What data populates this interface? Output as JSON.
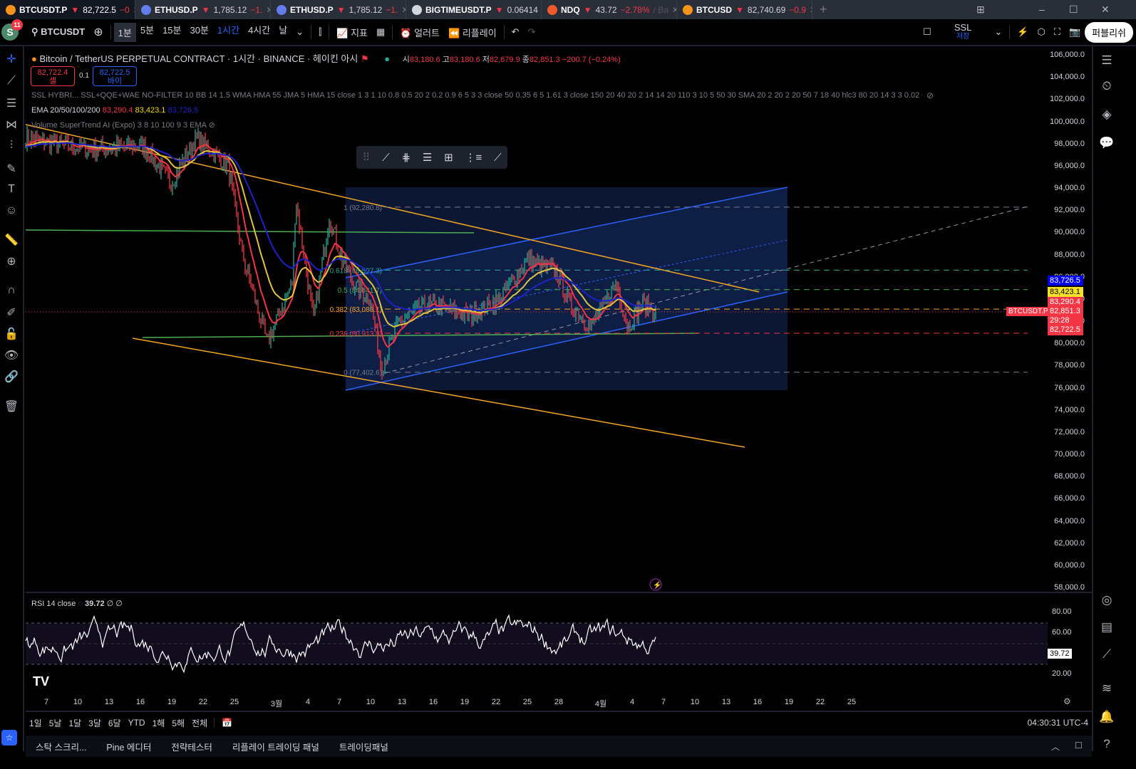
{
  "tabs": [
    {
      "symbol": "BTCUSDT.P",
      "price": "82,722.5",
      "change": "−0",
      "color": "#f7931a",
      "active": true
    },
    {
      "symbol": "ETHUSD.P",
      "price": "1,785.12",
      "change": "−1.",
      "color": "#627eea"
    },
    {
      "symbol": "ETHUSD.P",
      "price": "1,785.12",
      "change": "−1.",
      "color": "#627eea"
    },
    {
      "symbol": "BIGTIMEUSDT.P",
      "price": "0.06414",
      "change": "",
      "color": "#cfd8dc"
    },
    {
      "symbol": "NDQ",
      "price": "43.72",
      "change": "−2.78%",
      "extra": "/ Ba",
      "color": "#f0592a"
    },
    {
      "symbol": "BTCUSD",
      "price": "82,740.69",
      "change": "−0.9",
      "color": "#f7931a"
    }
  ],
  "toolbar": {
    "avatar": "S",
    "notif_count": "11",
    "symbol": "BTCUSDT",
    "intervals": [
      "1분",
      "5분",
      "15분",
      "30분",
      "1시간",
      "4시간",
      "날"
    ],
    "active_interval": "1시간",
    "indicators": "지표",
    "alert": "얼러트",
    "replay": "리플레이",
    "layout_name": "SSL",
    "layout_sub": "저장",
    "publish": "퍼블리쉬"
  },
  "legend": {
    "title": "Bitcoin / TetherUS PERPETUAL CONTRACT · 1시간 · BINANCE · 헤이킨 아시",
    "o_label": "시",
    "o": "83,180.6",
    "h_label": "고",
    "h": "83,180.6",
    "l_label": "저",
    "l": "82,679.9",
    "c": "82,851.3",
    "chg": "−200.7 (−0.24%)",
    "sell_price": "82,722.4",
    "sell_label": "셀",
    "spread": "0.1",
    "buy_price": "82,722.5",
    "buy_label": "바이",
    "ind1": "SSL HYBRI...  SSL+QQE+WAE NO-FILTER 10 BB 14 1.5 WMA HMA 55 JMA 5 HMA 15 close 1 3 1 10 0.8 0.5 20 2 0.2 0.9 6 5 3 3 close 50 0.35 6 5 1.61 3 close 150 20 40 20 2 14 14 20 110 3 10 5 50 30 SMA 20 2 20 2 20 50 7 18 40 hlc3 80 20 14 3 3 0.02 0.02 0.2 1...",
    "ind2_name": "EMA 20/50/100/200",
    "ema20": "83,290.4",
    "ema50": "83,423.1",
    "ema100": "83,726.5",
    "ind3": "Volume SuperTrend AI (Expo) 3 8 10 100 9 3 EMA"
  },
  "fib": [
    {
      "label": "1 (92,280.8)",
      "price": 92280.8
    },
    {
      "label": "0.618 (86,597.3)",
      "price": 86597.3
    },
    {
      "label": "0.5 (84,841.7)",
      "price": 84841.7
    },
    {
      "label": "0.382 (83,086.1)",
      "price": 83086.1
    },
    {
      "label": "0.236 (80,913.9)",
      "price": 80913.9
    },
    {
      "label": "0 (77,402.6)",
      "price": 77402.6
    }
  ],
  "price_axis": [
    "106,000.0",
    "104,000.0",
    "102,000.0",
    "100,000.0",
    "98,000.0",
    "96,000.0",
    "94,000.0",
    "92,000.0",
    "90,000.0",
    "88,000.0",
    "86,000.0",
    "84,000.0",
    "82,000.0",
    "80,000.0",
    "78,000.0",
    "76,000.0",
    "74,000.0",
    "72,000.0",
    "70,000.0",
    "68,000.0",
    "66,000.0",
    "64,000.0",
    "62,000.0",
    "60,000.0",
    "58,000.0"
  ],
  "price_tags": {
    "ema100": "83,726.5",
    "ema50": "83,423.1",
    "ema20": "83,290.4",
    "symbol": "BTCUSDT.P",
    "last": "82,851.3",
    "countdown": "29:28",
    "bid": "82,722.5"
  },
  "rsi": {
    "label": "RSI 14 close",
    "value": "39.72",
    "extra": "∅ ∅",
    "axis": [
      "80.00",
      "60.00",
      "20.00"
    ]
  },
  "time_axis": [
    "7",
    "10",
    "13",
    "16",
    "19",
    "22",
    "25",
    "3월",
    "4",
    "7",
    "10",
    "13",
    "16",
    "19",
    "22",
    "25",
    "28",
    "4월",
    "4",
    "7",
    "10",
    "13",
    "16",
    "19",
    "22",
    "25"
  ],
  "ranges": [
    "1일",
    "5날",
    "1달",
    "3달",
    "6달",
    "YTD",
    "1해",
    "5해",
    "전체"
  ],
  "clock": "04:30:31 UTC-4",
  "panels": [
    "스탁 스크리...",
    "Pine 에디터",
    "전략테스터",
    "리플레이 트레이딩 패널",
    "트레이딩패널"
  ],
  "colors": {
    "up": "#22ab94",
    "down": "#f23645",
    "ema20": "#f23645",
    "ema50": "#e0c341",
    "ema100": "#1e22c8",
    "fibrect": "#0d1a3a"
  }
}
